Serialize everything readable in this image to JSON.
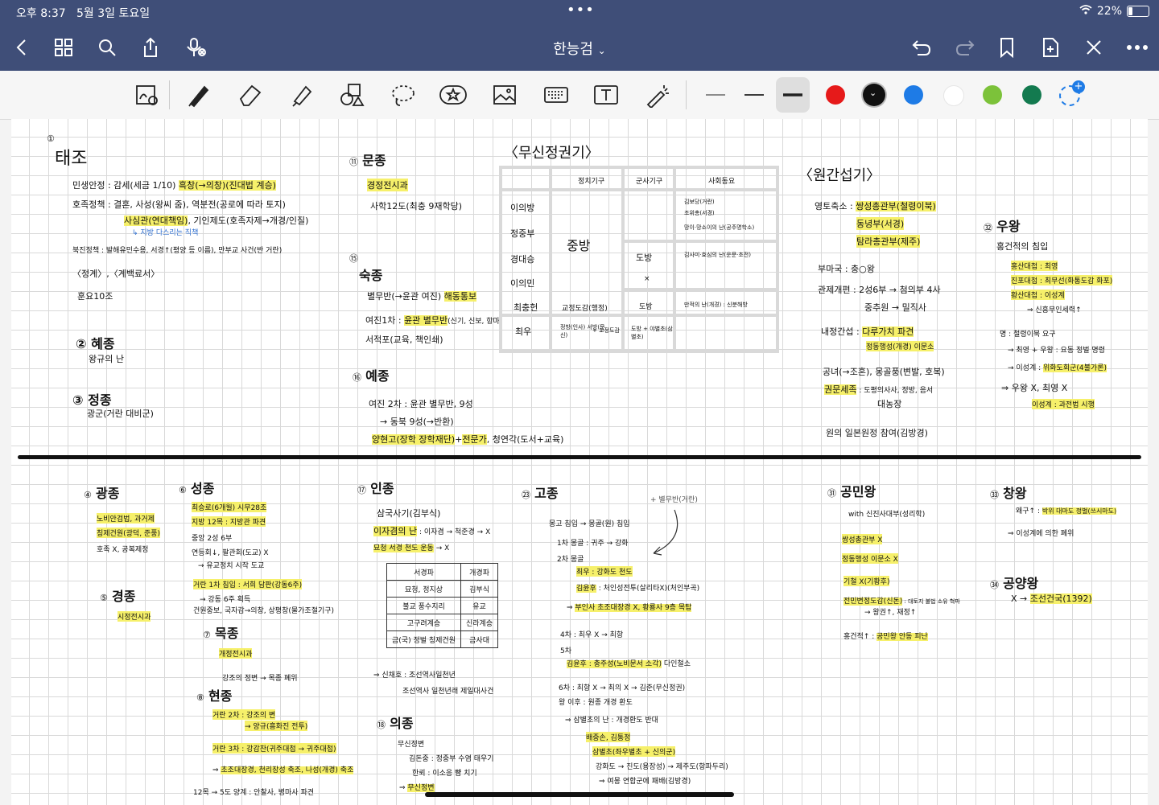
{
  "status": {
    "time": "오후 8:37",
    "date": "5월 3일 토요일",
    "battery": "22%",
    "battery_level": 0.22
  },
  "nav": {
    "title": "한능검"
  },
  "toolbar": {
    "colors": [
      "#e61a1a",
      "#111111",
      "#1e7be6",
      "#ffffff",
      "#7cc23a",
      "#137a4f"
    ]
  },
  "notes": {
    "taejo": {
      "num": "①",
      "title": "태조",
      "l1": "민생안정 : 감세(세금 1/10)",
      "l1hl": "흑창(→의창)(진대법 계승)",
      "l2": "호족정책 : 결혼, 사성(왕씨 줌),",
      "l2b": "역분전(공로에 따라 토지)",
      "l3hl": "사심관(연대책임)",
      "l3b": ", 기인제도(호족자제→개경/인질)",
      "l4": "↳ 지방 다스리는 직책",
      "l5": "북진정책 : 발해유민수용, 서경↑(평양 등 이름), 만부교 사건(반 거란)",
      "l6": "〈정계〉,〈계백료서〉",
      "l7": "훈요10조"
    },
    "hyejong": {
      "title": "② 혜종",
      "l1": "왕규의 난"
    },
    "jeongjong": {
      "title": "③ 정종",
      "l1": "광군(거란 대비군)"
    },
    "munjong": {
      "num": "⑪",
      "title": "문종",
      "l1hl": "경정전시과",
      "l2": "사학12도(최충 9재학당)"
    },
    "sukjong": {
      "num": "⑮",
      "title": "숙종",
      "l1": "별무반(→윤관 여진)",
      "l1hl": "해동통보",
      "l2": "여진1차 : ",
      "l2hl": "윤관 별무반",
      "l2b": "(신기, 신보, 항마)",
      "l3": "서적포(교육, 책인쇄)"
    },
    "yejong": {
      "num": "⑯",
      "title": "예종",
      "l1": "여진 2차 : 윤관 별무반, 9성",
      "l2": "→ 동북 9성(→반환)",
      "l3hl": "양현고(장학 장학재단)",
      "l3b": "+",
      "l3hl2": "전문가",
      "l3c": ", 청연각(도서+교육)"
    },
    "musin": {
      "title": "〈무신정권기〉",
      "cols": [
        "",
        "정치기구",
        "군사기구",
        "사회동요"
      ],
      "rows": [
        "이의방",
        "정중부",
        "경대승",
        "이의민",
        "최충헌",
        "최우"
      ],
      "c1": "중방",
      "c2": "도방",
      "c3": "×",
      "c4": "교정도감(행정)",
      "c5": "도방",
      "c6": "정방(인사) 서방(문신)",
      "c6b": "+ 교정도감",
      "c7": "도방 + 야별초(삼별초)",
      "s1": "김보당(거란)",
      "s1b": "조위총(서경)",
      "s2": "망이·망소이의 난(공주명학소)",
      "s3": "김사미·효심의 난(운문·초전)",
      "s4": "만적의 난(개경) : 신분해방"
    },
    "wongan": {
      "title": "〈원간섭기〉",
      "l1": "영토축소 : ",
      "l1hl": "쌍성총관부(철령이북)",
      "l2hl": "동녕부(서경)",
      "l3hl": "탐라총관부(제주)",
      "l4": "부마국 : 충○왕",
      "l5": "관제개편 : 2성6부 → 첨의부 4사",
      "l6": "중추원 → 밀직사",
      "l7": "내정간섭 : ",
      "l7hl": "다루가치 파견",
      "l8hl": "정동행성(개경) 이문소",
      "l9": "공녀(→조혼), 몽골풍(변발, 호복)",
      "l10hl": "권문세족",
      "l10b": " : 도평의사사, 정방, 음서",
      "l11": "대농장",
      "l12": "원의 일본원정 참여(김방경)"
    },
    "ujang": {
      "num": "㉜",
      "title": "우왕",
      "l1": "홍건적의 침입",
      "l2hl": "홍산대첩 : 최영",
      "l3hl": "진포대첩 : 최무선(화통도감 화포)",
      "l4hl": "황산대첩 : 이성계",
      "l5": "⇒ 신흥무인세력↑",
      "l6": "명 : 철령이북 요구",
      "l7": "→ 최영 + 우왕 : 요동 정벌 명령",
      "l8": "→ 이성계 : ",
      "l8hl": "위화도회군(4불가론)",
      "l9": "⇒ 우왕 X, 최영 X",
      "l10hl": "이성계 : 과전법 시행"
    },
    "gwangjong": {
      "num": "④",
      "title": "광종",
      "l1hl": "노비안검법, 과거제",
      "l2hl": "칭제건원(광덕, 준풍)",
      "l3": "호족 X, 공복제정"
    },
    "gyeongjong": {
      "num": "⑤",
      "title": "경종",
      "l1hl": "시정전시과"
    },
    "seongjong": {
      "num": "⑥",
      "title": "성종",
      "l1hl": "최승로(6개월) 시무28조",
      "l2hl": "지방 12목 : 지방관 파견",
      "l3": "중앙 2성 6부",
      "l4": "연등회↓, 팔관회(도교) X",
      "l5": "→ 유교정치 시작 도교",
      "l6hl": "거란 1차 침입 : 서희 담판(강동6주)",
      "l7": "→ 강동 6주 획득",
      "l8": "건원중보, 국자감→의창, 상평창(물가조절기구)"
    },
    "mokjong": {
      "num": "⑦",
      "title": "목종",
      "l1hl": "개정전시과",
      "l2": "강조의 정변 → 목종 폐위"
    },
    "hyeonjong": {
      "num": "⑧",
      "title": "현종",
      "l1hl": "거란 2차 : 강조의 변",
      "l2hl": "→ 양규(흥화진 전투)",
      "l3hl": "거란 3차 : 강감찬(귀주대첩 → 귀주대첩)",
      "l4": "⇒ ",
      "l4hl": "초조대장경, 천리장성 축조, 나성(개경) 축조",
      "l5": "12목 → 5도 양계 : 안찰사, 병마사 파견"
    },
    "injong": {
      "num": "⑰",
      "title": "인종",
      "l1": "삼국사기(김부식)",
      "l2hl": "이자겸의 난",
      "l2b": " : 이자겸 → 척준경 → X",
      "l3hl": "묘청 서경 천도 운동",
      "l3b": " → X",
      "tbl": [
        [
          "서경파",
          "개경파"
        ],
        [
          "묘청, 정지상",
          "김부식"
        ],
        [
          "불교 풍수지리",
          "유교"
        ],
        [
          "고구려계승",
          "신라계승"
        ],
        [
          "금(국) 정벌 칭제건원",
          "금사대"
        ]
      ],
      "l4": "⇒ 신채호 : 조선역사일천년",
      "l5": "조선역사 일천년래 제일대사건"
    },
    "uijong": {
      "num": "⑱",
      "title": "의종",
      "l1": "무신정변",
      "l2": "김돈중 : 정중부 수염 태우기",
      "l3": "한뢰 : 이소응 뺨 치기",
      "l4": "⇒ ",
      "l4hl": "무신정변"
    },
    "gojong": {
      "num": "㉓",
      "title": "고종",
      "l1": "몽고 침입 → 몽골(원) 침입",
      "l2": "1차 몽골 : 귀주 → 강화",
      "l3": "2차 몽골",
      "l4hl": "최우 : 강화도 천도",
      "l5hl": "김윤후",
      "l5b": " : 처인성전투(살리타X)(처인부곡)",
      "l6": "⇒ ",
      "l6hl": "부인사 초조대장경 X, 황룡사 9층 목탑",
      "l7": "4차 : 최우 X → 최항",
      "l8": "5차",
      "l9hl": "김윤후 : 충주성(노비문서 소각)",
      "l9b": " 다인철소",
      "l10": "6차 : 최항 X → 최의 X → 김준(무신정권)",
      "l11": "왕 이후 : 원종 개경 환도",
      "l12": "⇒ 삼별초의 난 : 개경환도 반대",
      "l13hl": "배중손, 김통정",
      "l14hl": "삼별초(좌우별초 + 신의군)",
      "l15": "강화도 → 진도(용장성) → 제주도(항파두리)",
      "l16": "⇒ 여몽 연합군에 패배(김방경)",
      "annot": "+ 별무반(거란)"
    },
    "gongmin": {
      "num": "㉛",
      "title": "공민왕",
      "l1": "with 신진사대부(성리학)",
      "l2hl": "쌍성총관부 X",
      "l3hl": "정동행성 이문소 X",
      "l4hl": "기철 X(기황후)",
      "l5hl": "전민변정도감(신돈)",
      "l5b": " : 대토지 불법 소유 혁파",
      "l6": "→ 왕권↑, 재정↑",
      "l7": "홍건적↑ : ",
      "l7hl": "공민왕 안동 피난"
    },
    "changwang": {
      "num": "㉝",
      "title": "창왕",
      "l1": "왜구↑ : ",
      "l1hl": "박위 대마도 정벌(쓰시마도)",
      "l2": "⇒ 이성계에 의한 폐위"
    },
    "gongyang": {
      "num": "㉞",
      "title": "공양왕",
      "l1": "X → ",
      "l1hl": "조선건국(1392)"
    }
  }
}
